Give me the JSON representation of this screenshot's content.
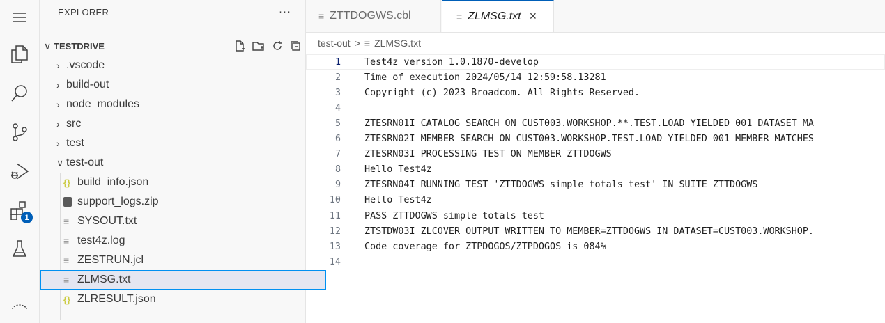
{
  "activity_bar": {
    "items": [
      {
        "icon": "menu-icon"
      },
      {
        "icon": "files-icon"
      },
      {
        "icon": "search-icon"
      },
      {
        "icon": "source-control-icon"
      },
      {
        "icon": "run-debug-icon"
      },
      {
        "icon": "extensions-icon",
        "badge": "1"
      },
      {
        "icon": "testing-icon"
      },
      {
        "icon": "accounts-icon"
      }
    ]
  },
  "explorer": {
    "title": "EXPLORER",
    "more": "···",
    "root": "TESTDRIVE",
    "items": [
      {
        "label": ".vscode",
        "type": "folder",
        "expanded": false
      },
      {
        "label": "build-out",
        "type": "folder",
        "expanded": false
      },
      {
        "label": "node_modules",
        "type": "folder",
        "expanded": false
      },
      {
        "label": "src",
        "type": "folder",
        "expanded": false
      },
      {
        "label": "test",
        "type": "folder",
        "expanded": false
      },
      {
        "label": "test-out",
        "type": "folder",
        "expanded": true
      },
      {
        "label": "build_info.json",
        "type": "json"
      },
      {
        "label": "support_logs.zip",
        "type": "zip"
      },
      {
        "label": "SYSOUT.txt",
        "type": "txt"
      },
      {
        "label": "test4z.log",
        "type": "txt"
      },
      {
        "label": "ZESTRUN.jcl",
        "type": "txt"
      },
      {
        "label": "ZLMSG.txt",
        "type": "txt",
        "selected": true
      },
      {
        "label": "ZLRESULT.json",
        "type": "json"
      }
    ]
  },
  "tabs": [
    {
      "label": "ZTTDOGWS.cbl",
      "active": false
    },
    {
      "label": "ZLMSG.txt",
      "active": true,
      "close": "×"
    }
  ],
  "breadcrumb": {
    "folder": "test-out",
    "sep": ">",
    "file": "ZLMSG.txt"
  },
  "editor": {
    "current_line": 1,
    "lines": [
      "Test4z version 1.0.1870-develop",
      "Time of execution 2024/05/14 12:59:58.13281",
      "Copyright (c) 2023 Broadcom. All Rights Reserved.",
      "",
      "ZTESRN01I CATALOG SEARCH ON CUST003.WORKSHOP.**.TEST.LOAD YIELDED 001 DATASET MA",
      "ZTESRN02I MEMBER SEARCH ON CUST003.WORKSHOP.TEST.LOAD YIELDED 001 MEMBER MATCHES",
      "ZTESRN03I PROCESSING TEST ON MEMBER ZTTDOGWS",
      "Hello Test4z",
      "ZTESRN04I RUNNING TEST 'ZTTDOGWS simple totals test' IN SUITE ZTTDOGWS",
      "Hello Test4z",
      "PASS ZTTDOGWS simple totals test",
      "ZTSTDW03I ZLCOVER OUTPUT WRITTEN TO MEMBER=ZTTDOGWS IN DATASET=CUST003.WORKSHOP.",
      "Code coverage for ZTPDOGOS/ZTPDOGOS is 084%",
      ""
    ]
  },
  "colors": {
    "accent": "#005fb8",
    "selection_bg": "#e4e6f1",
    "selection_border": "#0090f1"
  }
}
